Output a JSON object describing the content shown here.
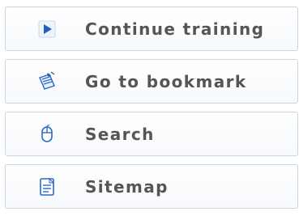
{
  "menu": {
    "items": [
      {
        "label": "Continue training",
        "icon": "play-icon"
      },
      {
        "label": "Go to bookmark",
        "icon": "bookmark-icon"
      },
      {
        "label": "Search",
        "icon": "search-icon"
      },
      {
        "label": "Sitemap",
        "icon": "sitemap-icon"
      }
    ]
  },
  "colors": {
    "accent": "#1f5fbf",
    "text": "#555555",
    "border": "#c7d6e6"
  }
}
